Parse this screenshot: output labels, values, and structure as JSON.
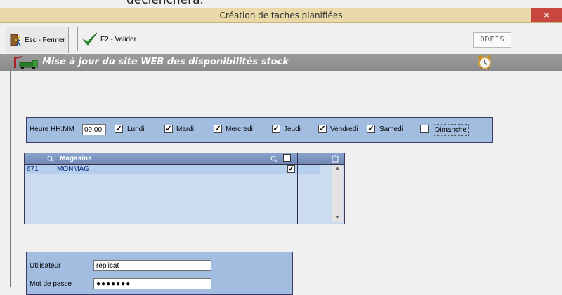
{
  "clipped_text": "déclenchera.",
  "window": {
    "title": "Création de taches planifiées",
    "close_glyph": "×"
  },
  "toolbar": {
    "esc_label": "Esc - Fermer",
    "f2_label": "F2 - Valider",
    "logo_text": "ODEIS",
    "esc_icon": "door-exit-icon",
    "f2_icon": "checkmark-icon"
  },
  "header": {
    "title": "Mise à jour du site WEB des disponibilités stock",
    "icon": "crane-truck-icon",
    "alarm_icon": "alarm-clock-icon"
  },
  "schedule": {
    "time_label_prefix": "H",
    "time_label_rest": "eure HH:MM",
    "time_value": "09:00",
    "days": [
      {
        "label": "Lundi",
        "checked": true
      },
      {
        "label": "Mardi",
        "checked": true
      },
      {
        "label": "Mercredi",
        "checked": true
      },
      {
        "label": "Jeudi",
        "checked": true
      },
      {
        "label": "Vendredi",
        "checked": true
      },
      {
        "label": "Samedi",
        "checked": true
      },
      {
        "label": "Dimanche",
        "checked": false
      }
    ]
  },
  "stores_grid": {
    "column_title": "Magasins",
    "rows": [
      {
        "code": "671",
        "name": "MONMAG",
        "checked": true
      }
    ]
  },
  "login": {
    "user_label": "Utilisateur",
    "user_value": "replicat",
    "password_label": "Mot de passe",
    "password_value": "●●●●●●●"
  },
  "colors": {
    "panel": "#a3bde0",
    "titlebar": "#ead8a8",
    "close": "#c7463d",
    "header_band": "#939393"
  }
}
